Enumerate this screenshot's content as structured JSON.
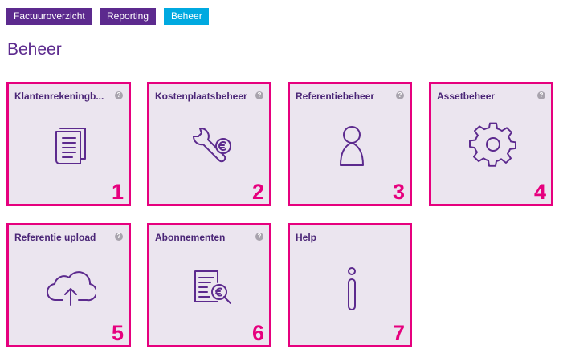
{
  "nav": {
    "tabs": [
      {
        "label": "Factuuroverzicht",
        "color": "#5c2a8e"
      },
      {
        "label": "Reporting",
        "color": "#5c2a8e"
      },
      {
        "label": "Beheer",
        "color": "#00a9e0"
      }
    ]
  },
  "page": {
    "title": "Beheer"
  },
  "colors": {
    "accent": "#e6007e",
    "brand": "#5c2a8e",
    "card_bg": "#ebe5ef"
  },
  "tiles": [
    {
      "label": "Klantenrekeningb...",
      "number": "1",
      "icon": "documents-icon",
      "has_help": true
    },
    {
      "label": "Kostenplaatsbeheer",
      "number": "2",
      "icon": "wrench-euro-icon",
      "has_help": true
    },
    {
      "label": "Referentiebeheer",
      "number": "3",
      "icon": "person-icon",
      "has_help": true
    },
    {
      "label": "Assetbeheer",
      "number": "4",
      "icon": "gear-icon",
      "has_help": true
    },
    {
      "label": "Referentie upload",
      "number": "5",
      "icon": "cloud-upload-icon",
      "has_help": true
    },
    {
      "label": "Abonnementen",
      "number": "6",
      "icon": "invoice-search-icon",
      "has_help": true
    },
    {
      "label": "Help",
      "number": "7",
      "icon": "info-icon",
      "has_help": false
    }
  ],
  "help_icon_glyph": "?"
}
